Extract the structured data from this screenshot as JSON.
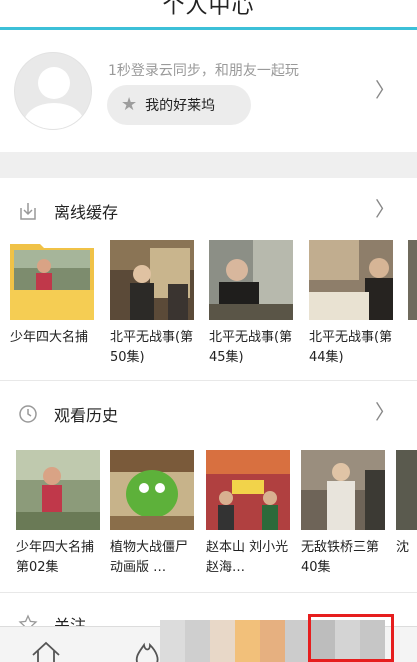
{
  "header": {
    "title": "个人中心",
    "accent_color": "#3cc0d8"
  },
  "profile": {
    "tagline": "1秒登录云同步，和朋友一起玩",
    "hollywood_label": "我的好莱坞",
    "avatar_icon": "default-avatar-icon"
  },
  "offline": {
    "title": "离线缓存",
    "icon": "download-icon",
    "items": [
      {
        "caption": "少年四大名捕",
        "kind": "folder"
      },
      {
        "caption": "北平无战事(第50集)"
      },
      {
        "caption": "北平无战事(第45集)"
      },
      {
        "caption": "北平无战事(第44集)"
      }
    ]
  },
  "history": {
    "title": "观看历史",
    "icon": "clock-icon",
    "items": [
      {
        "caption": "少年四大名捕 第02集"
      },
      {
        "caption": "植物大战僵尸动画版 …"
      },
      {
        "caption": "赵本山 刘小光 赵海…"
      },
      {
        "caption": "无敌铁桥三第40集"
      }
    ]
  },
  "follow": {
    "title": "关注",
    "icon": "star-outline-icon"
  },
  "bottom_bar": {
    "icons": [
      "home-icon",
      "fire-icon"
    ]
  }
}
